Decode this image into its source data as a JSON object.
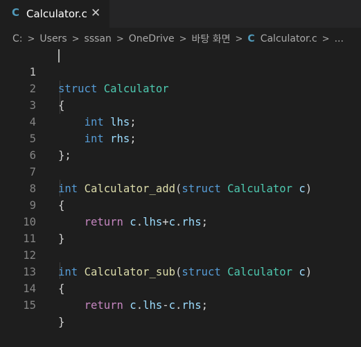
{
  "tab": {
    "lang_icon": "C",
    "label": "Calculator.c",
    "close_glyph": "✕"
  },
  "breadcrumb": {
    "items": [
      "C:",
      "Users",
      "sssan",
      "OneDrive",
      "바탕 화면",
      "Calculator.c",
      "..."
    ],
    "file_icon": "C"
  },
  "editor": {
    "line_numbers": [
      "1",
      "2",
      "3",
      "4",
      "5",
      "6",
      "7",
      "8",
      "9",
      "10",
      "11",
      "12",
      "13",
      "14",
      "15"
    ],
    "active_line": 1
  },
  "code": {
    "l1": {
      "kw": "struct",
      "sp": " ",
      "type": "Calculator"
    },
    "l2": {
      "text": "{"
    },
    "l3": {
      "kw": "int",
      "sp": " ",
      "var": "lhs",
      "punct": ";"
    },
    "l4": {
      "kw": "int",
      "sp": " ",
      "var": "rhs",
      "punct": ";"
    },
    "l5": {
      "text": "};"
    },
    "l6": {
      "text": ""
    },
    "l7": {
      "kw": "int",
      "sp": " ",
      "fn": "Calculator_add",
      "open": "(",
      "kw2": "struct",
      "sp2": " ",
      "type": "Calculator",
      "sp3": " ",
      "param": "c",
      "close": ")"
    },
    "l8": {
      "text": "{"
    },
    "l9": {
      "ctrl": "return",
      "sp": " ",
      "v1": "c",
      "p1": ".",
      "v2": "lhs",
      "op": "+",
      "v3": "c",
      "p2": ".",
      "v4": "rhs",
      "end": ";"
    },
    "l10": {
      "text": "}"
    },
    "l11": {
      "text": ""
    },
    "l12": {
      "kw": "int",
      "sp": " ",
      "fn": "Calculator_sub",
      "open": "(",
      "kw2": "struct",
      "sp2": " ",
      "type": "Calculator",
      "sp3": " ",
      "param": "c",
      "close": ")"
    },
    "l13": {
      "text": "{"
    },
    "l14": {
      "ctrl": "return",
      "sp": " ",
      "v1": "c",
      "p1": ".",
      "v2": "lhs",
      "op": "-",
      "v3": "c",
      "p2": ".",
      "v4": "rhs",
      "end": ";"
    },
    "l15": {
      "text": "}"
    }
  },
  "colors": {
    "keyword": "#569cd6",
    "type": "#4ec9b0",
    "function": "#dcdcaa",
    "variable": "#9cdcfe",
    "control": "#c586c0",
    "c_icon": "#519aba"
  }
}
